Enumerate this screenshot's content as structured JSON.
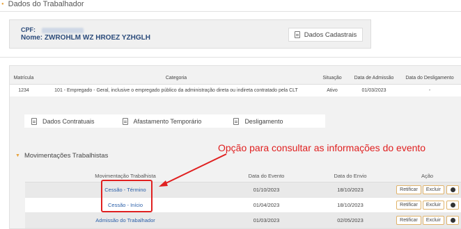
{
  "section": {
    "title": "Dados do Trabalhador"
  },
  "worker": {
    "cpf_label": "CPF:",
    "name_label": "Nome:",
    "name_value": "ZWROHLM WZ HROEZ YZHGLH",
    "dados_cadastrais_label": "Dados Cadastrais"
  },
  "contract_table": {
    "headers": [
      "Matrícula",
      "Categoria",
      "Situação",
      "Data de Admissão",
      "Data do Desligamento"
    ],
    "row": [
      "1234",
      "101 - Empregado - Geral, inclusive o empregado público da administração direta ou indireta contratado pela CLT",
      "Ativo",
      "01/03/2023",
      "-"
    ]
  },
  "tabs": [
    "Dados Contratuais",
    "Afastamento Temporário",
    "Desligamento"
  ],
  "movimentacoes": {
    "title": "Movimentações Trabalhistas",
    "headers": [
      "Movimentação Trabalhista",
      "Data do Evento",
      "Data do Envio",
      "Ação"
    ],
    "rows": [
      {
        "mov": "Cessão - Término",
        "evento": "01/10/2023",
        "envio": "18/10/2023"
      },
      {
        "mov": "Cessão - Início",
        "evento": "01/04/2023",
        "envio": "18/10/2023"
      },
      {
        "mov": "Admissão do Trabalhador",
        "evento": "01/03/2023",
        "envio": "02/05/2023"
      }
    ],
    "actions": {
      "retificar": "Retificar",
      "excluir": "Excluir"
    }
  },
  "annotation": "Opção para consultar as informações do evento",
  "colors": {
    "accent": "#e8a33d",
    "annotation": "#e02020",
    "link": "#2a5fa8"
  }
}
